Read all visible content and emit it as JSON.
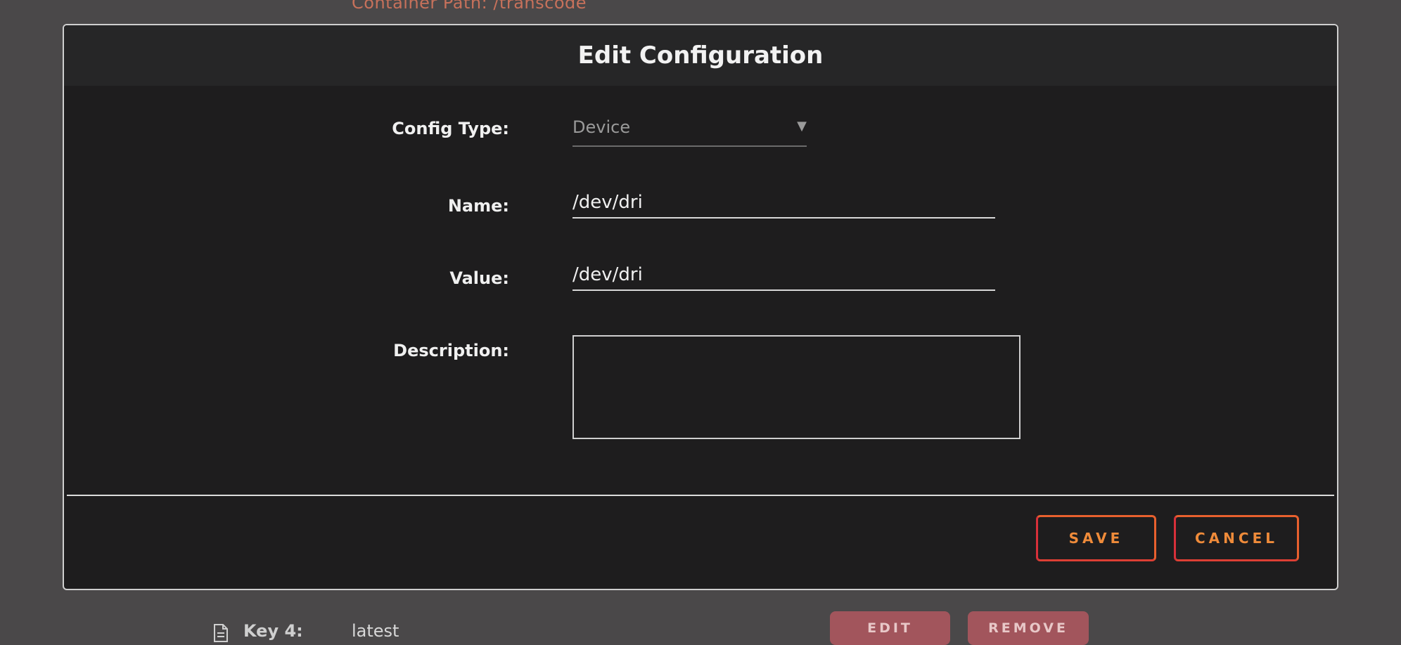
{
  "background": {
    "top_text": "Container Path: /transcode",
    "row": {
      "key_label": "Key 4:",
      "key_value": "latest",
      "edit_label": "EDIT",
      "remove_label": "REMOVE"
    }
  },
  "modal": {
    "title": "Edit Configuration",
    "fields": {
      "config_type": {
        "label": "Config Type:",
        "value": "Device",
        "options": [
          "Device"
        ]
      },
      "name": {
        "label": "Name:",
        "value": "/dev/dri"
      },
      "value": {
        "label": "Value:",
        "value": "/dev/dri"
      },
      "description": {
        "label": "Description:",
        "value": ""
      }
    },
    "actions": {
      "save_label": "SAVE",
      "cancel_label": "CANCEL"
    }
  },
  "colors": {
    "accent": "#ef8b3a",
    "accent_border": "#d8303a",
    "modal_bg": "#1e1d1e",
    "page_bg": "#4a4849",
    "background_button": "#a2555c"
  }
}
